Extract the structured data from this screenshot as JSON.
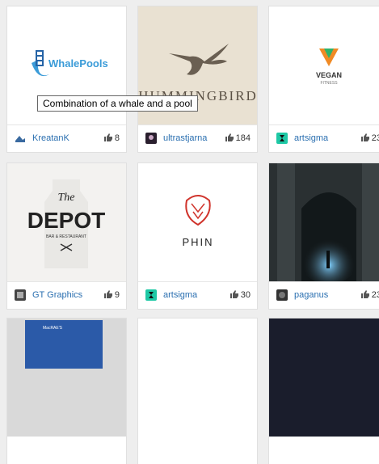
{
  "cards": [
    {
      "user": "KreatanK",
      "likes": "8",
      "logo": "WhalePools"
    },
    {
      "user": "ultrastjarna",
      "likes": "184",
      "logo": "HUMMINGBIRD"
    },
    {
      "user": "artsigma",
      "likes": "23",
      "logo": "VEGAN",
      "sub": "FITNESS"
    },
    {
      "user": "GT Graphics",
      "likes": "9",
      "logo1": "The",
      "logo2": "DEPOT",
      "sub": "BAR & RESTAURANT"
    },
    {
      "user": "artsigma",
      "likes": "30",
      "logo": "PHIN"
    },
    {
      "user": "paganus",
      "likes": "23"
    },
    {
      "logo": "MacRAE'S"
    },
    {},
    {}
  ],
  "tooltip": "Combination of a whale and a pool",
  "colors": {
    "link": "#2a6fb0",
    "page_bg": "#eeeeee",
    "card_bg": "#ffffff"
  }
}
